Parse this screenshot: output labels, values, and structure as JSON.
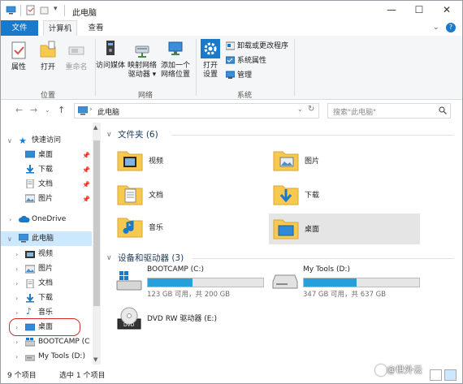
{
  "window": {
    "title": "此电脑",
    "help_glyph": "?",
    "controls": {
      "minimize": "—",
      "maximize": "☐",
      "close": "✕"
    }
  },
  "tabs": [
    {
      "label": "文件"
    },
    {
      "label": "计算机"
    },
    {
      "label": "查看"
    }
  ],
  "ribbon": {
    "location_group": {
      "label": "位置",
      "buttons": [
        {
          "label": "属性"
        },
        {
          "label": "打开"
        },
        {
          "label": "重命名"
        }
      ]
    },
    "network_group": {
      "label": "网络",
      "buttons": [
        {
          "label_line1": "访问媒体",
          "label_line2": ""
        },
        {
          "label_line1": "映射网络",
          "label_line2": "驱动器 ▾"
        },
        {
          "label_line1": "添加一个",
          "label_line2": "网络位置"
        }
      ]
    },
    "system_group": {
      "label": "系统",
      "open_settings": {
        "label_line1": "打开",
        "label_line2": "设置"
      },
      "items": [
        {
          "label": "卸载或更改程序"
        },
        {
          "label": "系统属性"
        },
        {
          "label": "管理"
        }
      ]
    }
  },
  "address": {
    "path": "此电脑",
    "search_placeholder": "搜索\"此电脑\""
  },
  "nav": {
    "quick_access": {
      "label": "快速访问"
    },
    "quick_items": [
      {
        "label": "桌面"
      },
      {
        "label": "下载"
      },
      {
        "label": "文档"
      },
      {
        "label": "图片"
      }
    ],
    "onedrive": {
      "label": "OneDrive"
    },
    "this_pc": {
      "label": "此电脑"
    },
    "pc_items": [
      {
        "label": "视频"
      },
      {
        "label": "图片"
      },
      {
        "label": "文档"
      },
      {
        "label": "下载"
      },
      {
        "label": "音乐"
      },
      {
        "label": "桌面"
      },
      {
        "label": "BOOTCAMP (C"
      },
      {
        "label": "My Tools (D:)"
      }
    ]
  },
  "content": {
    "folders_section": {
      "title": "文件夹 (6)"
    },
    "folders": [
      {
        "label": "视频"
      },
      {
        "label": "图片"
      },
      {
        "label": "文档"
      },
      {
        "label": "下载"
      },
      {
        "label": "音乐"
      },
      {
        "label": "桌面"
      }
    ],
    "drives_section": {
      "title": "设备和驱动器 (3)"
    },
    "drives": [
      {
        "label": "BOOTCAMP (C:)",
        "info": "123 GB 可用，共 200 GB",
        "used_fraction": 0.385
      },
      {
        "label": "My Tools (D:)",
        "info": "347 GB 可用，共 637 GB",
        "used_fraction": 0.455
      },
      {
        "label": "DVD RW 驱动器 (E:)",
        "info": ""
      }
    ]
  },
  "status": {
    "item_count": "9 个项目",
    "selection": "选中 1 个项目"
  },
  "watermark": {
    "text": "@世外云"
  },
  "colors": {
    "accent": "#1979ca",
    "selection": "#e5e5e5",
    "drive_fill": "#26a0da",
    "folder": "#f8c94f"
  }
}
